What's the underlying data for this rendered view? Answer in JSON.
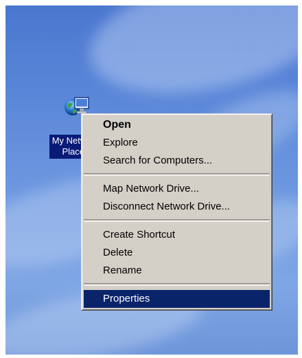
{
  "desktop": {
    "icon_label": "My Network Places"
  },
  "context_menu": {
    "groups": [
      [
        {
          "label": "Open",
          "bold": true
        },
        {
          "label": "Explore"
        },
        {
          "label": "Search for Computers..."
        }
      ],
      [
        {
          "label": "Map Network Drive..."
        },
        {
          "label": "Disconnect Network Drive..."
        }
      ],
      [
        {
          "label": "Create Shortcut"
        },
        {
          "label": "Delete"
        },
        {
          "label": "Rename"
        }
      ],
      [
        {
          "label": "Properties",
          "selected": true
        }
      ]
    ]
  },
  "colors": {
    "selection": "#0a246a",
    "menu_background": "#d4d0c8",
    "icon_label_background": "#0a1a78"
  },
  "icons": {
    "desktop_icon": "network-places-icon"
  }
}
